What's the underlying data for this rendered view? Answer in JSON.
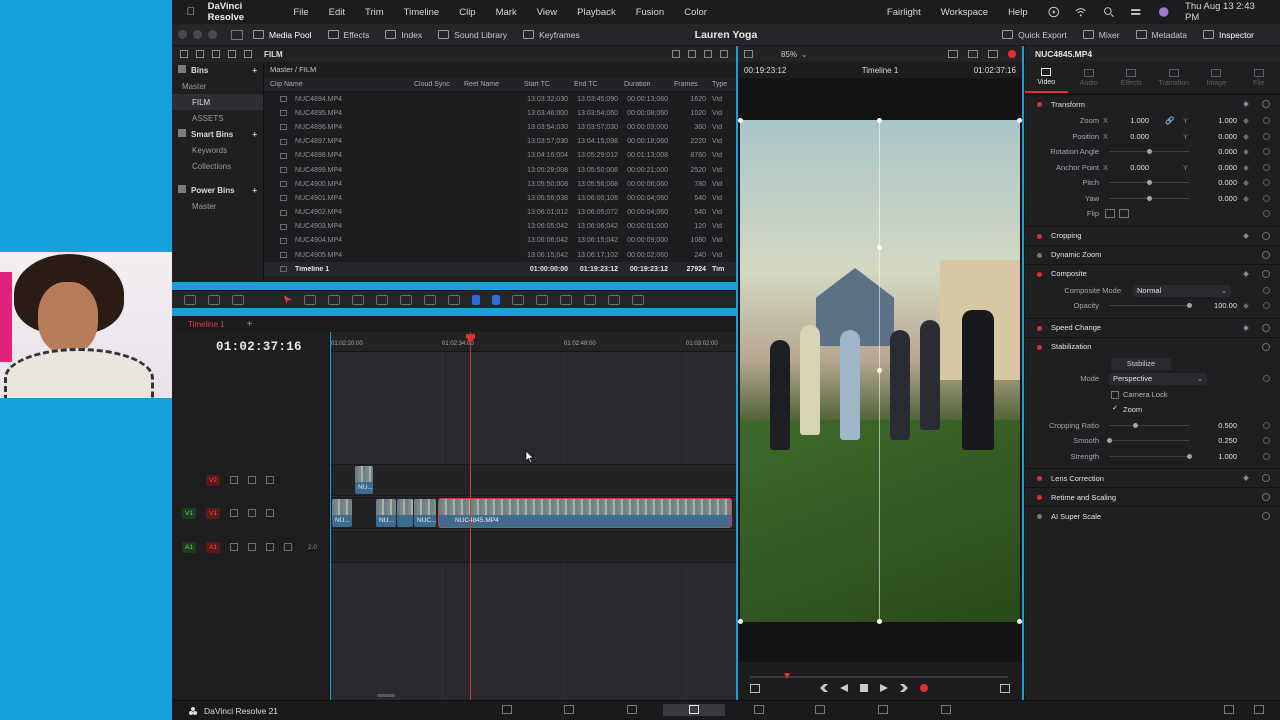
{
  "menubar": {
    "app": "DaVinci Resolve",
    "items": [
      "File",
      "Edit",
      "Trim",
      "Timeline",
      "Clip",
      "Mark",
      "View",
      "Playback",
      "Fusion",
      "Color"
    ],
    "right_items": [
      "Fairlight",
      "Workspace",
      "Help"
    ],
    "datetime": "Thu Aug 13  2:43 PM"
  },
  "toolbar": {
    "project_title": "Lauren Yoga",
    "left": [
      "Media Pool",
      "Effects",
      "Index",
      "Sound Library",
      "Keyframes"
    ],
    "right": [
      "Quick Export",
      "Mixer",
      "Metadata",
      "Inspector"
    ]
  },
  "subtoolbar": {
    "folder": "FILM"
  },
  "bins": {
    "header": "Bins",
    "master": "Master",
    "items": [
      "FILM",
      "ASSETS"
    ],
    "smart_header": "Smart Bins",
    "smart_items": [
      "Keywords",
      "Collections"
    ],
    "power_header": "Power Bins",
    "power_items": [
      "Master"
    ]
  },
  "cliplist": {
    "path": "Master / FILM",
    "columns": [
      "Clip Name",
      "Cloud Sync",
      "Reel Name",
      "Start TC",
      "End TC",
      "Duration",
      "Frames",
      "Type"
    ],
    "rows": [
      {
        "name": "NUC4894.MP4",
        "start": "13:03:32;030",
        "end": "13:03:45;090",
        "dur": "00:00:13;060",
        "frames": "1620",
        "type": "Vid"
      },
      {
        "name": "NUC4895.MP4",
        "start": "13:03:46;000",
        "end": "13:03:54;060",
        "dur": "00:00:08;060",
        "frames": "1020",
        "type": "Vid"
      },
      {
        "name": "NUC4896.MP4",
        "start": "13:03:54;030",
        "end": "13:03:57;030",
        "dur": "00:00:03;000",
        "frames": "360",
        "type": "Vid"
      },
      {
        "name": "NUC4897.MP4",
        "start": "13:03:57;030",
        "end": "13:04:15;098",
        "dur": "00:00:18;060",
        "frames": "2220",
        "type": "Vid"
      },
      {
        "name": "NUC4898.MP4",
        "start": "13:04:16;004",
        "end": "13:05:29;012",
        "dur": "00:01:13;008",
        "frames": "8760",
        "type": "Vid"
      },
      {
        "name": "NUC4899.MP4",
        "start": "13:05:29;008",
        "end": "13:05:50;008",
        "dur": "00:00:21;000",
        "frames": "2520",
        "type": "Vid"
      },
      {
        "name": "NUC4900.MP4",
        "start": "13:05:50;008",
        "end": "13:05:56;068",
        "dur": "00:00:06;060",
        "frames": "780",
        "type": "Vid"
      },
      {
        "name": "NUC4901.MP4",
        "start": "13:05:56;038",
        "end": "13:06:00;106",
        "dur": "00:00:04;060",
        "frames": "540",
        "type": "Vid"
      },
      {
        "name": "NUC4902.MP4",
        "start": "13:06:01;012",
        "end": "13:06:05;072",
        "dur": "00:00:04;060",
        "frames": "540",
        "type": "Vid"
      },
      {
        "name": "NUC4903.MP4",
        "start": "13:06:05;042",
        "end": "13:06:06;042",
        "dur": "00:00:01;000",
        "frames": "120",
        "type": "Vid"
      },
      {
        "name": "NUC4904.MP4",
        "start": "13:06:06;042",
        "end": "13:06:15;042",
        "dur": "00:00:09;000",
        "frames": "1080",
        "type": "Vid"
      },
      {
        "name": "NUC4905.MP4",
        "start": "13:06:15;042",
        "end": "13:06:17;102",
        "dur": "00:00:02;060",
        "frames": "240",
        "type": "Vid"
      },
      {
        "name": "Timeline 1",
        "start": "01:00:00:00",
        "end": "01:19:23:12",
        "dur": "00:19:23:12",
        "frames": "27924",
        "type": "Tim"
      }
    ]
  },
  "timeline": {
    "tab": "Timeline 1",
    "timecode": "01:02:37:16",
    "ruler": [
      "01:02:20:00",
      "01:02:34:00",
      "01:02:48:00",
      "01:03:02:00"
    ],
    "tracks": [
      {
        "id": "V2",
        "label": "V2"
      },
      {
        "id": "V1",
        "label": "V1"
      },
      {
        "id": "A1",
        "label": "A1",
        "volume": "2.0"
      }
    ],
    "clips": [
      "NU...",
      "NU...",
      "NU...",
      "NUC...",
      "NUC4845.MP4"
    ]
  },
  "viewer": {
    "zoom": "85%",
    "timecode_left": "00:19:23:12",
    "timeline_name": "Timeline 1",
    "timecode_right": "01:02:37:16"
  },
  "inspector": {
    "clip_name": "NUC4845.MP4",
    "tabs": [
      "Video",
      "Audio",
      "Effects",
      "Transition",
      "Image",
      "File"
    ],
    "transform": {
      "title": "Transform",
      "zoom_label": "Zoom",
      "zoom_x": "1.000",
      "zoom_y": "1.000",
      "position_label": "Position",
      "position_x": "0.000",
      "position_y": "0.000",
      "rotation_label": "Rotation Angle",
      "rotation": "0.000",
      "anchor_label": "Anchor Point",
      "anchor_x": "0.000",
      "anchor_y": "0.000",
      "pitch_label": "Pitch",
      "pitch": "0.000",
      "yaw_label": "Yaw",
      "yaw": "0.000",
      "flip_label": "Flip",
      "x": "X",
      "y": "Y"
    },
    "sections": [
      "Cropping",
      "Dynamic Zoom",
      "Composite"
    ],
    "composite": {
      "mode_label": "Composite Mode",
      "mode": "Normal",
      "opacity_label": "Opacity",
      "opacity": "100.00"
    },
    "speed_change": "Speed Change",
    "stabilization": {
      "title": "Stabilization",
      "button": "Stabilize",
      "mode_label": "Mode",
      "mode": "Perspective",
      "camera_lock": "Camera Lock",
      "zoom": "Zoom",
      "cropping_ratio_label": "Cropping Ratio",
      "cropping_ratio": "0.500",
      "smooth_label": "Smooth",
      "smooth": "0.250",
      "strength_label": "Strength",
      "strength": "1.000"
    },
    "more_sections": [
      "Lens Correction",
      "Retime and Scaling",
      "AI Super Scale"
    ]
  },
  "pagebar": {
    "app_version": "DaVinci Resolve 21"
  }
}
